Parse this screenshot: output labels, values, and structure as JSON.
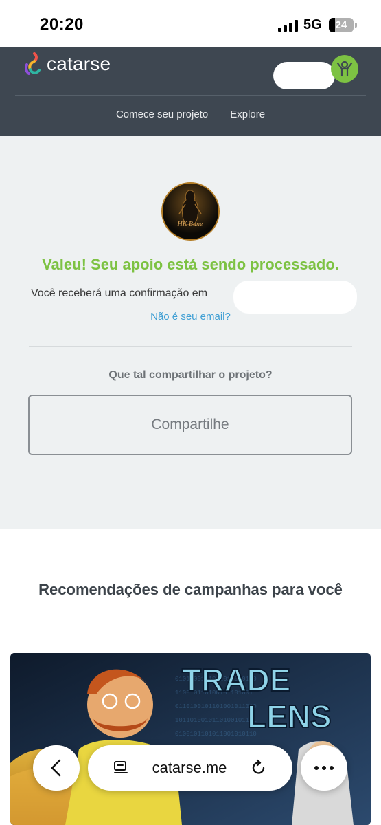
{
  "status_bar": {
    "time": "20:20",
    "network": "5G",
    "battery_percent": "24",
    "battery_level": 0.24
  },
  "header": {
    "logo_text": "catarse",
    "nav": [
      "Comece seu projeto",
      "Explore"
    ],
    "avatar_icon": "supporter-icon"
  },
  "confirmation": {
    "project_avatar_text": "HK Bane",
    "headline": "Valeu! Seu apoio está sendo processado.",
    "confirm_text": "Você receberá uma confirmação em",
    "not_your_email": "Não é seu email?",
    "share_question": "Que tal compartilhar o projeto?",
    "share_button": "Compartilhe"
  },
  "recommendations": {
    "title": "Recomendações de campanhas para você",
    "cards": [
      {
        "title_line1": "TRADE",
        "title_line2": "LENS"
      }
    ]
  },
  "browser": {
    "url": "catarse.me",
    "back_icon": "chevron-left-icon",
    "tabs_icon": "tabs-icon",
    "reload_icon": "reload-icon",
    "more_icon": "more-icon"
  },
  "colors": {
    "header_bg": "#3e4751",
    "accent_green": "#7dc243",
    "link_blue": "#3f9fd4",
    "panel_bg": "#eef1f2"
  }
}
